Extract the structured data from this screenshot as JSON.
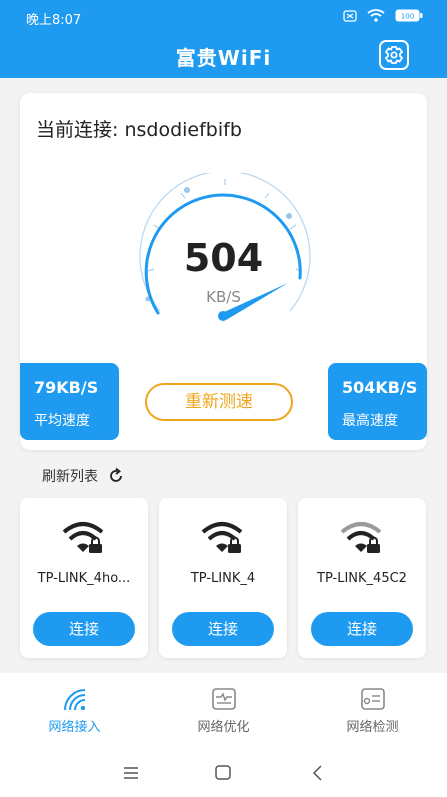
{
  "status": {
    "time": "晚上8:07",
    "battery": "100"
  },
  "header": {
    "title": "富贵WiFi"
  },
  "main": {
    "connection_label": "当前连接: nsdodiefbifb",
    "speed_value": "504",
    "speed_unit": "KB/S",
    "avg": {
      "value": "79KB/S",
      "label": "平均速度"
    },
    "max": {
      "value": "504KB/S",
      "label": "最高速度"
    },
    "retest_label": "重新测速"
  },
  "list": {
    "refresh_label": "刷新列表",
    "networks": [
      {
        "name": "TP-LINK_4ho...",
        "button": "连接"
      },
      {
        "name": "TP-LINK_4",
        "button": "连接"
      },
      {
        "name": "TP-LINK_45C2",
        "button": "连接"
      }
    ]
  },
  "tabs": [
    {
      "label": "网络接入",
      "icon": "wifi-signal-icon"
    },
    {
      "label": "网络优化",
      "icon": "optimize-icon"
    },
    {
      "label": "网络检测",
      "icon": "detect-icon"
    }
  ],
  "colors": {
    "accent": "#1e9bf0",
    "orange": "#f0a51e"
  }
}
